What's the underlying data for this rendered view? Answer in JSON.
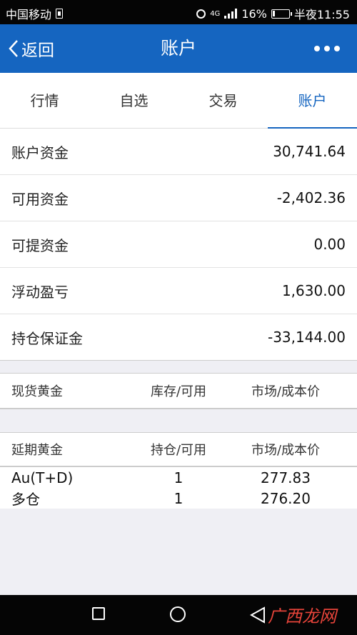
{
  "status_bar": {
    "carrier": "中国移动",
    "network": "4G",
    "battery_percent": "16%",
    "battery_level": 0.16,
    "time": "半夜11:55"
  },
  "app_bar": {
    "back_label": "返回",
    "title": "账户"
  },
  "tabs": [
    {
      "label": "行情",
      "active": false
    },
    {
      "label": "自选",
      "active": false
    },
    {
      "label": "交易",
      "active": false
    },
    {
      "label": "账户",
      "active": true
    }
  ],
  "account": {
    "rows": [
      {
        "label": "账户资金",
        "value": "30,741.64"
      },
      {
        "label": "可用资金",
        "value": "-2,402.36"
      },
      {
        "label": "可提资金",
        "value": "0.00"
      },
      {
        "label": "浮动盈亏",
        "value": "1,630.00"
      },
      {
        "label": "持仓保证金",
        "value": "-33,144.00"
      }
    ]
  },
  "spot_gold": {
    "headers": [
      "现货黄金",
      "库存/可用",
      "市场/成本价"
    ]
  },
  "deferred_gold": {
    "headers": [
      "延期黄金",
      "持仓/可用",
      "市场/成本价"
    ],
    "rows": [
      [
        "Au(T+D)",
        "1",
        "277.83"
      ],
      [
        "多仓",
        "1",
        "276.20"
      ]
    ]
  },
  "watermark": "广西龙网"
}
